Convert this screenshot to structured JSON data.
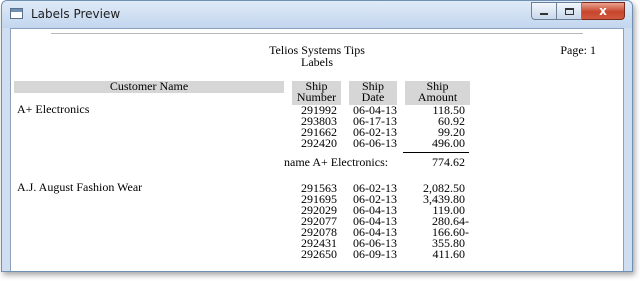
{
  "window": {
    "title": "Labels Preview",
    "icon": "report-icon",
    "close_glyph": "x"
  },
  "report": {
    "company": "Telios Systems Tips",
    "subtitle": "Labels",
    "page_label": "Page: 1",
    "columns": {
      "customer": "Customer Name",
      "ship_number_1": "Ship",
      "ship_number_2": "Number",
      "ship_date_1": "Ship",
      "ship_date_2": "Date",
      "ship_amount_1": "Ship",
      "ship_amount_2": "Amount"
    },
    "groups": [
      {
        "customer": "A+ Electronics",
        "rows": [
          {
            "number": "291992",
            "date": "06-04-13",
            "amount": "118.50"
          },
          {
            "number": "293803",
            "date": "06-17-13",
            "amount": "60.92"
          },
          {
            "number": "291662",
            "date": "06-02-13",
            "amount": "99.20"
          },
          {
            "number": "292420",
            "date": "06-06-13",
            "amount": "496.00"
          }
        ],
        "total_label": "name  A+ Electronics:",
        "total": "774.62"
      },
      {
        "customer": "A.J. August Fashion Wear",
        "rows": [
          {
            "number": "291563",
            "date": "06-02-13",
            "amount": "2,082.50"
          },
          {
            "number": "291695",
            "date": "06-02-13",
            "amount": "3,439.80"
          },
          {
            "number": "292029",
            "date": "06-04-13",
            "amount": "119.00"
          },
          {
            "number": "292077",
            "date": "06-04-13",
            "amount": "280.64-"
          },
          {
            "number": "292078",
            "date": "06-04-13",
            "amount": "166.60-"
          },
          {
            "number": "292431",
            "date": "06-06-13",
            "amount": "355.80"
          },
          {
            "number": "292650",
            "date": "06-09-13",
            "amount": "411.60"
          }
        ]
      }
    ]
  }
}
